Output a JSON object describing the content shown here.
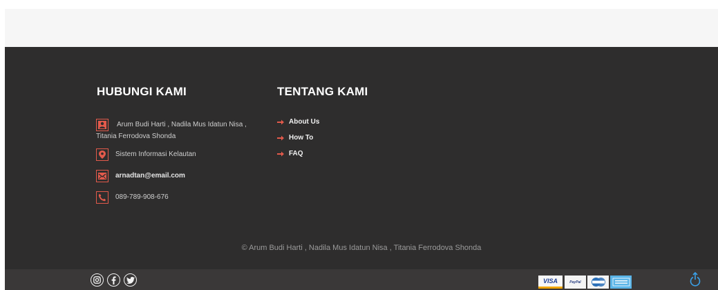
{
  "contact": {
    "title": "HUBUNGI KAMI",
    "name": "Arum Budi Harti , Nadila Mus Idatun Nisa , Titania Ferrodova Shonda",
    "org": "Sistem Informasi Kelautan",
    "email": "arnadtan@email.com",
    "phone": "089-789-908-676"
  },
  "about": {
    "title": "TENTANG KAMI",
    "links": [
      "About Us",
      "How To",
      "FAQ"
    ]
  },
  "copyright": "© Arum Budi Harti , Nadila Mus Idatun Nisa , Titania Ferrodova Shonda",
  "payment_methods": [
    "VISA",
    "PayPal",
    "MasterCard",
    "American Express"
  ],
  "social": [
    "instagram-icon",
    "facebook-icon",
    "twitter-icon"
  ],
  "colors": {
    "accent": "#e35a4b",
    "footer_bg": "#2e2d2d",
    "bottom_bar": "#3a3838",
    "scroll_top": "#3aa0e8"
  }
}
